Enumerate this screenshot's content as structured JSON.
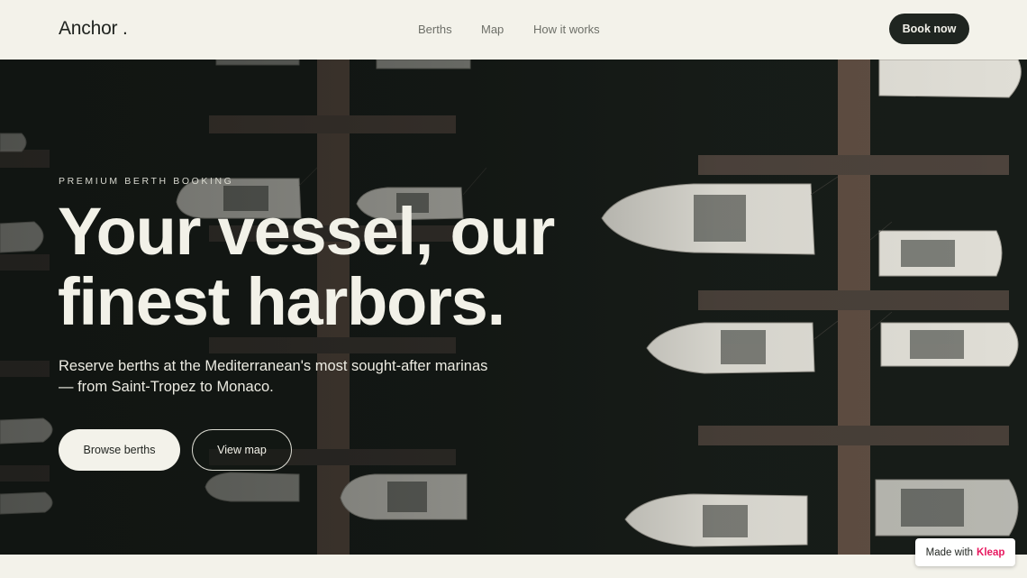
{
  "header": {
    "logo": "Anchor .",
    "nav": [
      "Berths",
      "Map",
      "How it works"
    ],
    "cta_label": "Book now"
  },
  "hero": {
    "eyebrow": "PREMIUM BERTH BOOKING",
    "headline_line1": "Your vessel, our",
    "headline_line2": "finest harbors.",
    "subtext": "Reserve berths at the Mediterranean's most sought-after marinas — from Saint-Tropez to Monaco.",
    "primary_button": "Browse berths",
    "secondary_button": "View map"
  },
  "badge": {
    "prefix": "Made with",
    "brand": "Kleap"
  },
  "colors": {
    "background": "#f3f2ea",
    "dark": "#1f2520",
    "water": "#181d19",
    "brand_accent": "#e8185f"
  }
}
